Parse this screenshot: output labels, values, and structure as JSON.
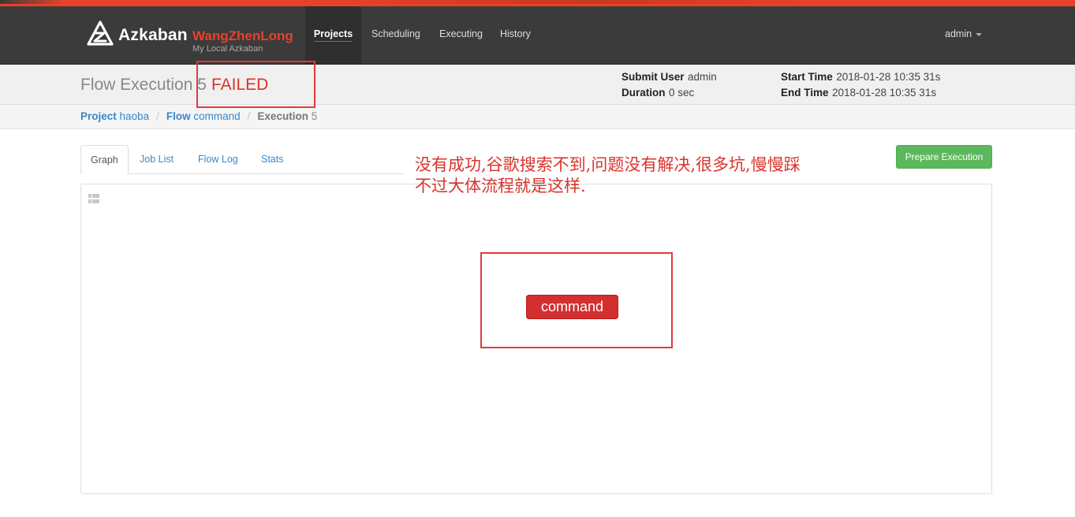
{
  "brand": {
    "name": "Azkaban",
    "instance_name": "WangZhenLong",
    "instance_subtitle": "My Local Azkaban"
  },
  "nav": {
    "items": [
      {
        "label": "Projects",
        "active": true
      },
      {
        "label": "Scheduling",
        "active": false
      },
      {
        "label": "Executing",
        "active": false
      },
      {
        "label": "History",
        "active": false
      }
    ],
    "user_menu": "admin"
  },
  "execution": {
    "title_prefix": "Flow Execution",
    "execution_id": "5",
    "status": "FAILED",
    "submit_user_label": "Submit User",
    "submit_user": "admin",
    "duration_label": "Duration",
    "duration": "0 sec",
    "start_time_label": "Start Time",
    "start_time": "2018-01-28 10:35 31s",
    "end_time_label": "End Time",
    "end_time": "2018-01-28 10:35 31s"
  },
  "breadcrumb": {
    "project_label": "Project",
    "project": "haoba",
    "flow_label": "Flow",
    "flow": "command",
    "execution_label": "Execution",
    "execution": "5"
  },
  "tabs": [
    {
      "label": "Graph",
      "active": true
    },
    {
      "label": "Job List",
      "active": false
    },
    {
      "label": "Flow Log",
      "active": false
    },
    {
      "label": "Stats",
      "active": false
    }
  ],
  "actions": {
    "prepare_execution": "Prepare Execution"
  },
  "graph": {
    "nodes": [
      {
        "label": "command",
        "status": "FAILED"
      }
    ]
  },
  "annotation": {
    "line1": "没有成功,谷歌搜索不到,问题没有解决,很多坑,慢慢踩",
    "line2": "不过大体流程就是这样."
  },
  "colors": {
    "accent": "#e8412a",
    "failed": "#d32f2f",
    "link": "#3a87c8",
    "success_button": "#5cb85c",
    "navbar": "#3b3b3b"
  }
}
